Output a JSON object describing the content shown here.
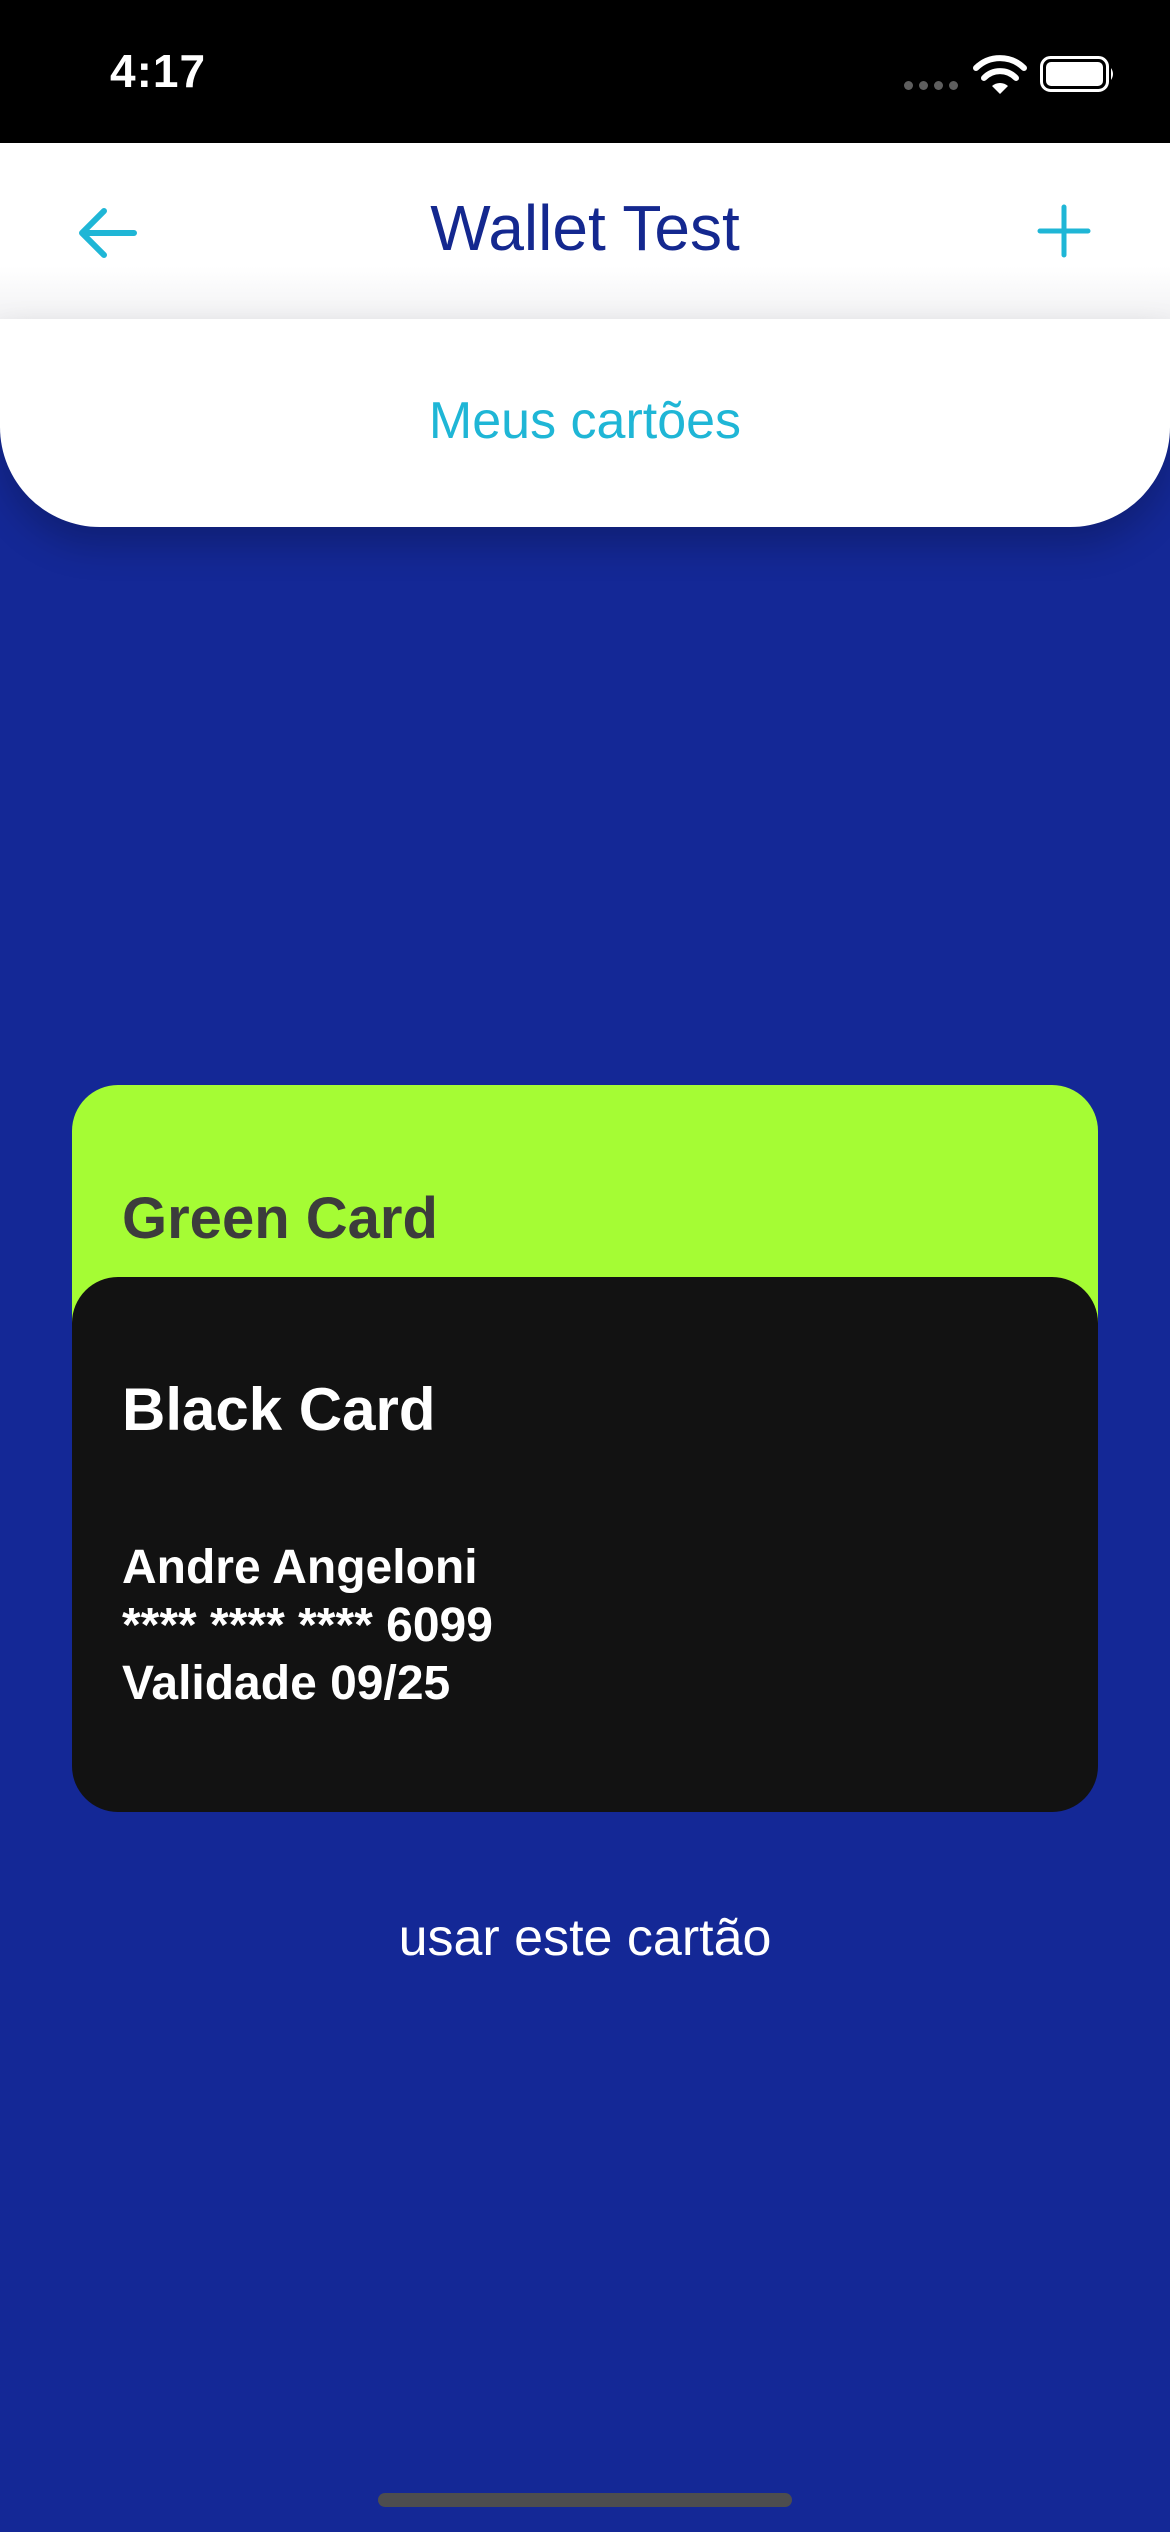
{
  "status_bar": {
    "time": "4:17"
  },
  "header": {
    "title": "Wallet Test",
    "back_icon": "arrow-left-icon",
    "add_icon": "plus-icon"
  },
  "sheet": {
    "title": "Meus cartões"
  },
  "cards": [
    {
      "name": "Green Card",
      "color": "#a5fc34"
    },
    {
      "name": "Black Card",
      "color": "#121212",
      "holder": "Andre Angeloni",
      "number": "**** **** **** 6099",
      "validity": "Validade 09/25"
    }
  ],
  "actions": {
    "use_card_label": "usar este cartão"
  },
  "colors": {
    "background": "#142896",
    "accent": "#1fb6d6",
    "title": "#14288f"
  }
}
